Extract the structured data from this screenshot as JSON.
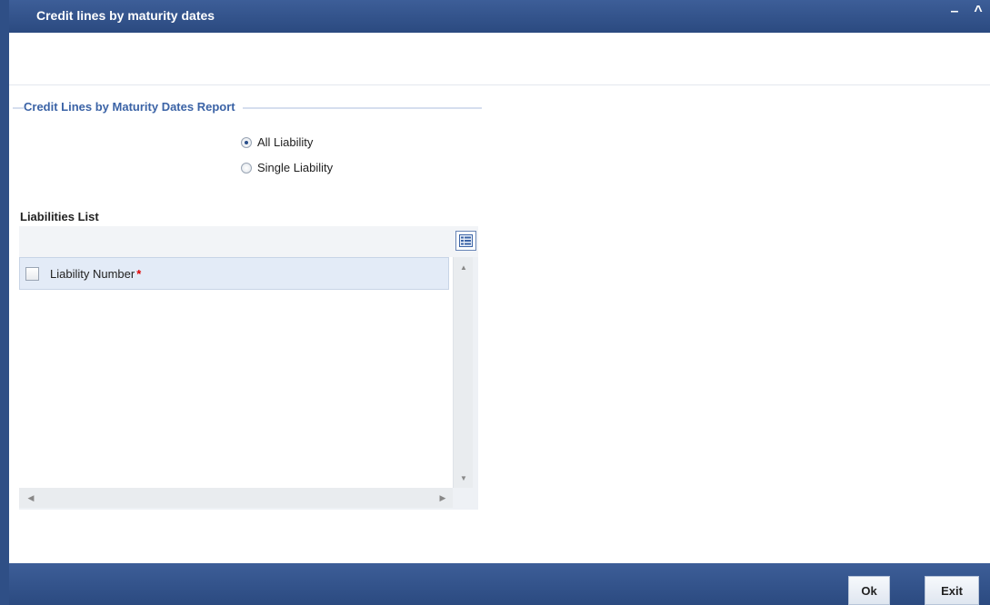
{
  "window": {
    "title": "Credit lines by maturity dates",
    "minimize_glyph": "–",
    "maximize_glyph": "^"
  },
  "report": {
    "legend": "Credit Lines by Maturity Dates Report",
    "options": [
      {
        "label": "All Liability",
        "checked": true
      },
      {
        "label": "Single Liability",
        "checked": false
      }
    ]
  },
  "liabilities": {
    "title": "Liabilities List",
    "columns": [
      {
        "label": "Liability Number",
        "required_mark": "*"
      }
    ],
    "rows": []
  },
  "footer": {
    "ok_label": "Ok",
    "exit_label": "Exit"
  },
  "colors": {
    "titlebar": "#2f4f86",
    "legend": "#3b63a6",
    "required": "#e00000"
  },
  "icons": {
    "grid_menu": "list-columns-icon",
    "scroll_up": "arrow-up-icon",
    "scroll_down": "arrow-down-icon",
    "scroll_left": "arrow-left-icon",
    "scroll_right": "arrow-right-icon"
  }
}
